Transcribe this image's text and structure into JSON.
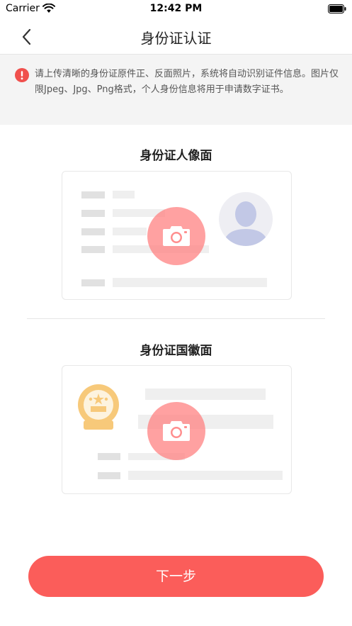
{
  "status_bar": {
    "carrier": "Carrier",
    "time": "12:42 PM"
  },
  "nav": {
    "title": "身份证认证"
  },
  "notice": {
    "text": "请上传清晰的身份证原件正、反面照片，系统将自动识别证件信息。图片仅限Jpeg、Jpg、Png格式，个人身份信息将用于申请数字证书。"
  },
  "front": {
    "title": "身份证人像面"
  },
  "back": {
    "title": "身份证国徽面"
  },
  "footer": {
    "next_label": "下一步"
  },
  "colors": {
    "accent": "#fb5d5a",
    "notice_icon": "#f0504d",
    "emblem": "#f7c97a",
    "avatar": "#c2c8e6"
  },
  "icons": [
    "wifi-icon",
    "battery-icon",
    "back-chevron-icon",
    "info-icon",
    "camera-icon",
    "avatar-icon",
    "emblem-icon"
  ]
}
